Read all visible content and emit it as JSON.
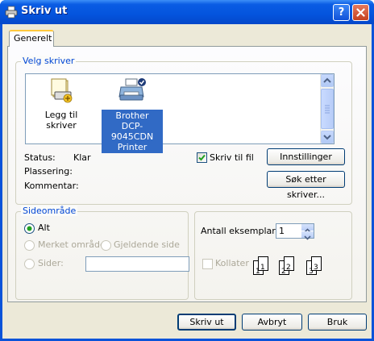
{
  "window": {
    "title": "Skriv ut",
    "help_label": "?",
    "close_label": "✕"
  },
  "tabs": [
    {
      "label": "Generelt"
    }
  ],
  "select_printer": {
    "group_title": "Velg skriver",
    "printers": [
      {
        "label": "Legg til skriver",
        "icon": "add-printer-icon"
      },
      {
        "label_lines": [
          "Brother",
          "DCP-9045CDN",
          "Printer"
        ],
        "icon": "printer-icon",
        "selected": true
      }
    ]
  },
  "printer_info": {
    "status_label": "Status:",
    "status_value": "Klar",
    "location_label": "Plassering:",
    "comment_label": "Kommentar:",
    "print_to_file_label": "Skriv til fil",
    "print_to_file_checked": true,
    "preferences_button": "Innstillinger",
    "find_printer_button": "Søk etter skriver..."
  },
  "page_range": {
    "group_title": "Sideområde",
    "all_label": "Alt",
    "selection_label": "Merket område",
    "current_page_label": "Gjeldende side",
    "pages_label": "Sider:",
    "pages_value": ""
  },
  "copies": {
    "label": "Antall eksemplarer:",
    "value": "1",
    "collate_label": "Kollater",
    "collate_checked": false,
    "collate_pages": [
      "1",
      "1",
      "2",
      "2",
      "3",
      "3"
    ]
  },
  "buttons": {
    "print": "Skriv ut",
    "cancel": "Avbryt",
    "apply": "Bruk"
  },
  "colors": {
    "titlebar": "#0454dd",
    "accent": "#0046d5",
    "face": "#ece9d8",
    "selection": "#316ac5"
  }
}
